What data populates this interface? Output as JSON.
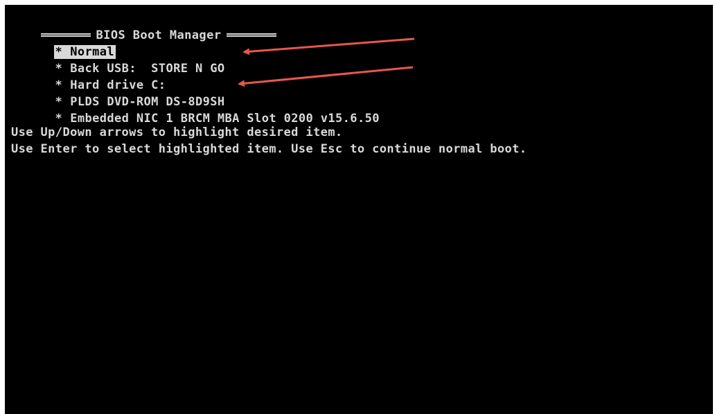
{
  "title": "BIOS Boot Manager",
  "bullet": "*",
  "boot_items": [
    {
      "label": "Normal"
    },
    {
      "label": "Back USB:  STORE N GO"
    },
    {
      "label": "Hard drive C:"
    },
    {
      "label": "PLDS DVD-ROM DS-8D9SH"
    },
    {
      "label": "Embedded NIC 1 BRCM MBA Slot 0200 v15.6.50"
    }
  ],
  "help": [
    "Use Up/Down arrows to highlight desired item.",
    "Use Enter to select highlighted item. Use Esc to continue normal boot."
  ],
  "colors": {
    "background": "#000000",
    "text": "#d9d9d9",
    "highlight": "#d9d9d9",
    "annotation_arrow": "#e8574e"
  }
}
